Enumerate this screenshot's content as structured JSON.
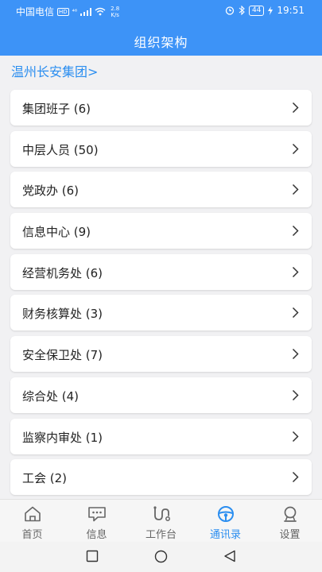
{
  "status_bar": {
    "carrier": "中国电信",
    "hd": "HD",
    "signal": "⁴⁶",
    "speed_value": "2.8",
    "speed_unit": "K/s",
    "battery": "44",
    "time": "19:51"
  },
  "header": {
    "title": "组织架构"
  },
  "breadcrumb": "温州长安集团>",
  "departments": [
    {
      "label": "集团班子 (6)"
    },
    {
      "label": "中层人员 (50)"
    },
    {
      "label": "党政办 (6)"
    },
    {
      "label": "信息中心 (9)"
    },
    {
      "label": "经营机务处 (6)"
    },
    {
      "label": "财务核算处 (3)"
    },
    {
      "label": "安全保卫处 (7)"
    },
    {
      "label": "综合处 (4)"
    },
    {
      "label": "监察内审处 (1)"
    },
    {
      "label": "工会 (2)"
    }
  ],
  "tabs": [
    {
      "label": "首页",
      "icon": "home-icon"
    },
    {
      "label": "信息",
      "icon": "message-icon"
    },
    {
      "label": "工作台",
      "icon": "workbench-icon"
    },
    {
      "label": "通讯录",
      "icon": "contacts-icon",
      "active": true
    },
    {
      "label": "设置",
      "icon": "settings-icon"
    }
  ],
  "colors": {
    "primary": "#3d93f7",
    "accent": "#2b8ef0",
    "background": "#f1f1f3"
  }
}
